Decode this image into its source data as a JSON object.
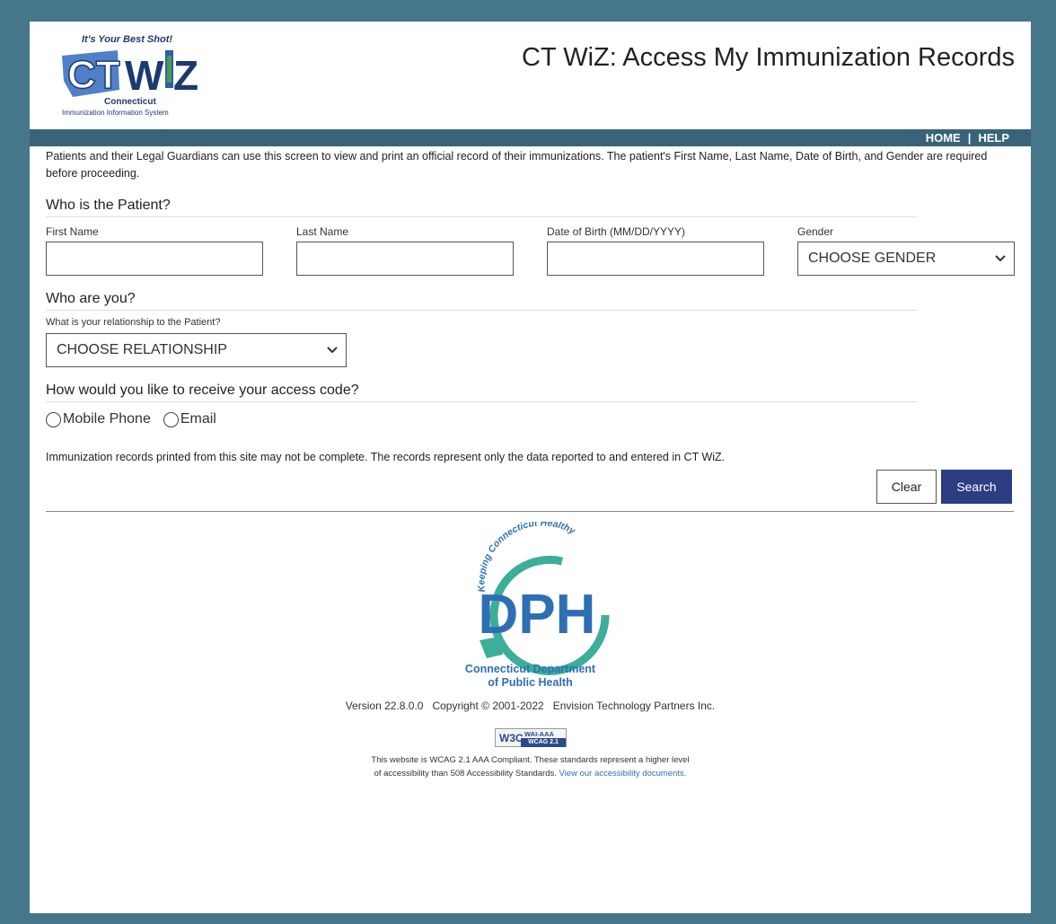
{
  "logo": {
    "tagline": "It's Your Best Shot!",
    "wordmark": "CT WiZ",
    "state": "Connecticut",
    "system": "Immunization Information System"
  },
  "header": {
    "title": "CT WiZ: Access My Immunization Records"
  },
  "nav": {
    "home": "HOME",
    "separator": "|",
    "help": "HELP"
  },
  "intro": "Patients and their Legal Guardians can use this screen to view and print an official record of their immunizations. The patient's First Name, Last Name, Date of Birth, and Gender are required before proceeding.",
  "patient": {
    "heading": "Who is the Patient?",
    "first_name_label": "First Name",
    "first_name_value": "",
    "last_name_label": "Last Name",
    "last_name_value": "",
    "dob_label": "Date of Birth (MM/DD/YYYY)",
    "dob_value": "",
    "gender_label": "Gender",
    "gender_selected": "CHOOSE GENDER"
  },
  "requester": {
    "heading": "Who are you?",
    "relationship_label": "What is your relationship to the Patient?",
    "relationship_selected": "CHOOSE RELATIONSHIP"
  },
  "access_code": {
    "heading": "How would you like to receive your access code?",
    "options": [
      "Mobile Phone",
      "Email"
    ],
    "selected": null
  },
  "note": "Immunization records printed from this site may not be complete. The records represent only the data reported to and entered in CT WiZ.",
  "buttons": {
    "clear": "Clear",
    "search": "Search"
  },
  "dph": {
    "arc_text": "Keeping Connecticut Healthy",
    "letters": "DPH",
    "name_line1": "Connecticut Department",
    "name_line2": "of Public Health"
  },
  "footer": {
    "version": "Version 22.8.0.0   Copyright © 2001-2022   Envision Technology Partners Inc.",
    "badge_w3c": "W3C",
    "badge_level": "WAI-AAA",
    "badge_wcag": "WCAG 2.1",
    "wcag_text": "This website is WCAG 2.1 AAA Compliant. These standards represent a higher level of accessibility than 508 Accessibility Standards.",
    "wcag_link": "View our accessibility documents."
  },
  "colors": {
    "frame": "#457689",
    "navbar": "#386378",
    "search_button": "#2d3d82",
    "dph_blue": "#2e6fb4",
    "dph_teal": "#3cae9a"
  }
}
